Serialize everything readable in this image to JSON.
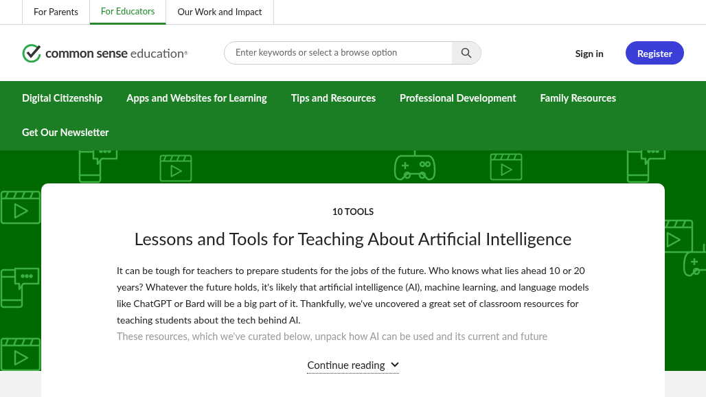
{
  "top_tabs": [
    {
      "label": "For Parents",
      "selected": false
    },
    {
      "label": "For Educators",
      "selected": true
    },
    {
      "label": "Our Work and Impact",
      "selected": false
    }
  ],
  "logo": {
    "bold": "common sense",
    "light": "education",
    "mark": "®"
  },
  "search": {
    "placeholder": "Enter keywords or select a browse option"
  },
  "sign_in": "Sign in",
  "register": "Register",
  "nav": [
    "Digital Citizenship",
    "Apps and Websites for Learning",
    "Tips and Resources",
    "Professional Development",
    "Family Resources",
    "Get Our Newsletter"
  ],
  "card": {
    "eyebrow": "10 TOOLS",
    "title": "Lessons and Tools for Teaching About Artificial Intelligence",
    "paragraph": "It can be tough for teachers to prepare students for the jobs of the future. Who knows what lies ahead 10 or 20 years? Whatever the future holds, it's likely that artificial intelligence (AI), machine learning, and language models like ChatGPT or Bard will be a big part of it. Thankfully, we've uncovered a great set of classroom resources for teaching students about the tech behind AI.",
    "faded_line": "These resources, which we've curated below, unpack how AI can be used and its current and future",
    "continue": "Continue reading"
  }
}
